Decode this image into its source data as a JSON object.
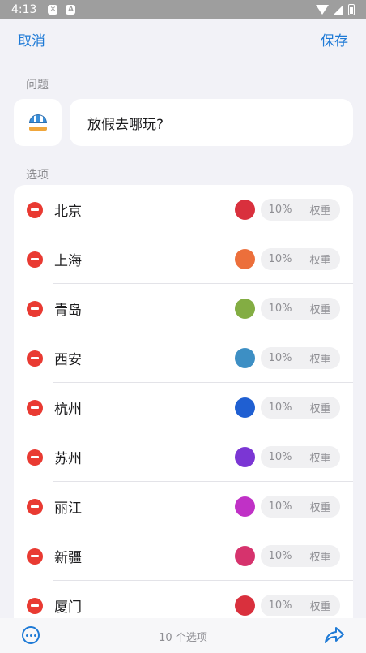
{
  "status_bar": {
    "time": "4:13"
  },
  "nav": {
    "cancel_label": "取消",
    "save_label": "保存"
  },
  "question_section": {
    "label": "问题",
    "icon": "beach-umbrella-icon",
    "text": "放假去哪玩?"
  },
  "options_section": {
    "label": "选项",
    "options": [
      {
        "name": "北京",
        "color": "#d9303d",
        "percent": "10%",
        "weight_label": "权重"
      },
      {
        "name": "上海",
        "color": "#ec6f3b",
        "percent": "10%",
        "weight_label": "权重"
      },
      {
        "name": "青岛",
        "color": "#83ad43",
        "percent": "10%",
        "weight_label": "权重"
      },
      {
        "name": "西安",
        "color": "#3d8fc4",
        "percent": "10%",
        "weight_label": "权重"
      },
      {
        "name": "杭州",
        "color": "#1f5fd2",
        "percent": "10%",
        "weight_label": "权重"
      },
      {
        "name": "苏州",
        "color": "#7b36d4",
        "percent": "10%",
        "weight_label": "权重"
      },
      {
        "name": "丽江",
        "color": "#c031c6",
        "percent": "10%",
        "weight_label": "权重"
      },
      {
        "name": "新疆",
        "color": "#d6336d",
        "percent": "10%",
        "weight_label": "权重"
      },
      {
        "name": "厦门",
        "color": "#d9303d",
        "percent": "10%",
        "weight_label": "权重"
      }
    ]
  },
  "bottom_bar": {
    "count_text": "10 个选项",
    "more_icon": "more-icon",
    "share_icon": "share-icon"
  },
  "colors": {
    "accent": "#1e7ad6",
    "remove": "#e93a32",
    "background": "#f2f2f7"
  }
}
